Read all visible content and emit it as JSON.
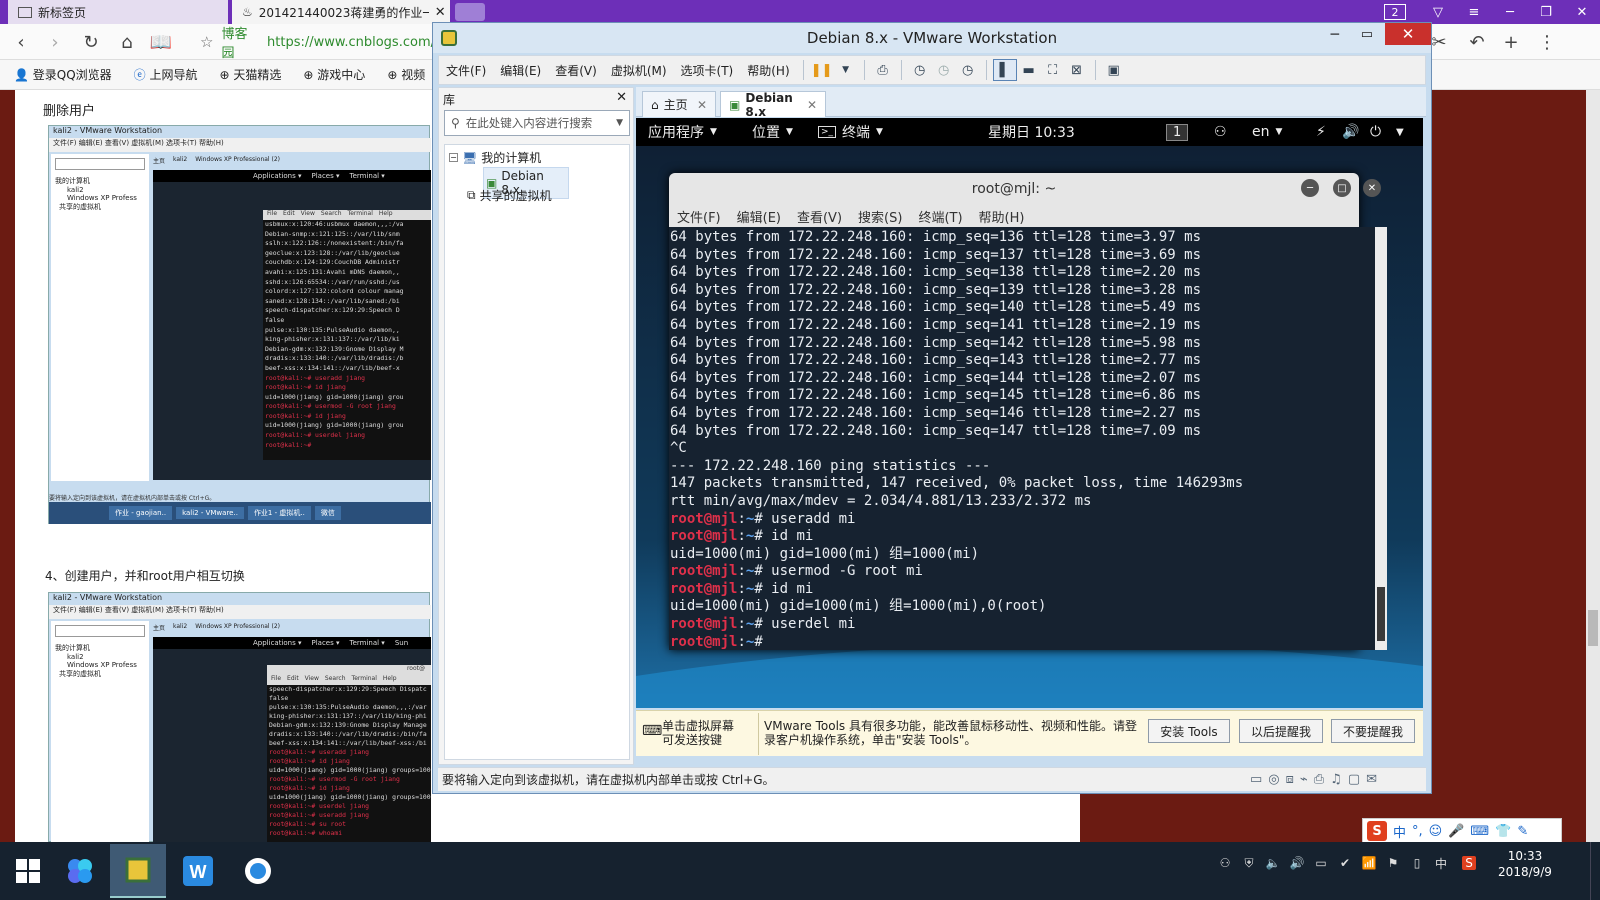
{
  "browser": {
    "tabs": [
      {
        "label": "新标签页"
      },
      {
        "label": "201421440023蒋建勇的作业一"
      }
    ],
    "tab_count_badge": "2",
    "url_site": "博客园",
    "url": "https://www.cnblogs.com/",
    "bookmarks": [
      "登录QQ浏览器",
      "上网导航",
      "天猫精选",
      "游戏中心",
      "视频"
    ]
  },
  "page": {
    "heading_delete_user": "删除用户",
    "heading_section4": "4、创建用户，并和root用户相互切换",
    "shot1": {
      "title": "kali2 - VMware Workstation",
      "tree": [
        "我的计算机",
        "kali2",
        "Windows XP Profess",
        "共享的虚拟机"
      ],
      "tabs": [
        "主页",
        "kali2",
        "Windows XP Professional (2)"
      ],
      "gnome": [
        "Applications ▾",
        "Places ▾",
        "Terminal ▾"
      ],
      "term_menu": [
        "File",
        "Edit",
        "View",
        "Search",
        "Terminal",
        "Help"
      ],
      "lines": [
        "usbmux:x:120:46:usbmux daemon,,,:/va",
        "Debian-snmp:x:121:125::/var/lib/snm",
        "sslh:x:122:126::/nonexistent:/bin/fa",
        "geoclue:x:123:128::/var/lib/geoclue",
        "couchdb:x:124:129:CouchDB Administr",
        "avahi:x:125:131:Avahi mDNS daemon,,",
        "sshd:x:126:65534::/var/run/sshd:/us",
        "colord:x:127:132:colord colour manag",
        "saned:x:128:134::/var/lib/saned:/bi",
        "speech-dispatcher:x:129:29:Speech D",
        "false",
        "pulse:x:130:135:PulseAudio daemon,,",
        "king-phisher:x:131:137::/var/lib/ki",
        "Debian-gdm:x:132:139:Gnome Display M",
        "dradis:x:133:140::/var/lib/dradis:/b",
        "beef-xss:x:134:141::/var/lib/beef-x",
        "root@kali:~# useradd jiang",
        "root@kali:~# id jiang",
        "uid=1000(jiang) gid=1000(jiang) grou",
        "root@kali:~# usermod -G root jiang",
        "root@kali:~# id jiang",
        "uid=1000(jiang) gid=1000(jiang) grou",
        "root@kali:~# userdel jiang",
        "root@kali:~# "
      ],
      "status": "要将输入定向到该虚拟机，请在虚拟机内部单击或按 Ctrl+G。",
      "taskbar": [
        "作业 - gaojian..",
        "kali2 - VMware..",
        "作业1 - 虚拟机..",
        "微信"
      ]
    },
    "shot2": {
      "title": "kali2 - VMware Workstation",
      "tree": [
        "我的计算机",
        "kali2",
        "Windows XP Profess",
        "共享的虚拟机"
      ],
      "tabs": [
        "主页",
        "kali2",
        "Windows XP Professional (2)"
      ],
      "gnome": [
        "Applications ▾",
        "Places ▾",
        "Terminal ▾",
        "Sun"
      ],
      "term_menu": [
        "File",
        "Edit",
        "View",
        "Search",
        "Terminal",
        "Help"
      ],
      "term_title": "root@",
      "lines": [
        "speech-dispatcher:x:129:29:Speech Dispatc",
        "false",
        "pulse:x:130:135:PulseAudio daemon,,,:/var",
        "king-phisher:x:131:137::/var/lib/king-phi",
        "Debian-gdm:x:132:139:Gnome Display Manage",
        "dradis:x:133:140::/var/lib/dradis:/bin/fa",
        "beef-xss:x:134:141::/var/lib/beef-xss:/bi",
        "root@kali:~# useradd jiang",
        "root@kali:~# id jiang",
        "uid=1000(jiang) gid=1000(jiang) groups=100",
        "root@kali:~# usermod -G root jiang",
        "root@kali:~# id jiang",
        "uid=1000(jiang) gid=1000(jiang) groups=1000(jiang),0(root)",
        "root@kali:~# userdel jiang",
        "root@kali:~# useradd jiang",
        "root@kali:~# su root",
        "root@kali:~# whoami"
      ]
    }
  },
  "vmware": {
    "title": "Debian 8.x - VMware Workstation",
    "menus": [
      "文件(F)",
      "编辑(E)",
      "查看(V)",
      "虚拟机(M)",
      "选项卡(T)",
      "帮助(H)"
    ],
    "library_title": "库",
    "search_placeholder": "在此处键入内容进行搜索",
    "tree": {
      "my_computer": "我的计算机",
      "vm": "Debian 8.x",
      "shared": "共享的虚拟机"
    },
    "tabs": [
      {
        "label": "主页"
      },
      {
        "label": "Debian 8.x"
      }
    ],
    "guest": {
      "gnome_apps": "应用程序",
      "gnome_places": "位置",
      "gnome_terminal": "终端",
      "clock": "星期日 10:33",
      "workspace": "1",
      "lang": "en"
    },
    "terminal": {
      "title": "root@mjl: ~",
      "menus": [
        "文件(F)",
        "编辑(E)",
        "查看(V)",
        "搜索(S)",
        "终端(T)",
        "帮助(H)"
      ],
      "lines": [
        {
          "text": "64 bytes from 172.22.248.160: icmp_seq=136 ttl=128 time=3.97 ms"
        },
        {
          "text": "64 bytes from 172.22.248.160: icmp_seq=137 ttl=128 time=3.69 ms"
        },
        {
          "text": "64 bytes from 172.22.248.160: icmp_seq=138 ttl=128 time=2.20 ms"
        },
        {
          "text": "64 bytes from 172.22.248.160: icmp_seq=139 ttl=128 time=3.28 ms"
        },
        {
          "text": "64 bytes from 172.22.248.160: icmp_seq=140 ttl=128 time=5.49 ms"
        },
        {
          "text": "64 bytes from 172.22.248.160: icmp_seq=141 ttl=128 time=2.19 ms"
        },
        {
          "text": "64 bytes from 172.22.248.160: icmp_seq=142 ttl=128 time=5.98 ms"
        },
        {
          "text": "64 bytes from 172.22.248.160: icmp_seq=143 ttl=128 time=2.77 ms"
        },
        {
          "text": "64 bytes from 172.22.248.160: icmp_seq=144 ttl=128 time=2.07 ms"
        },
        {
          "text": "64 bytes from 172.22.248.160: icmp_seq=145 ttl=128 time=6.86 ms"
        },
        {
          "text": "64 bytes from 172.22.248.160: icmp_seq=146 ttl=128 time=2.27 ms"
        },
        {
          "text": "64 bytes from 172.22.248.160: icmp_seq=147 ttl=128 time=7.09 ms"
        },
        {
          "text": "^C"
        },
        {
          "text": "--- 172.22.248.160 ping statistics ---"
        },
        {
          "text": "147 packets transmitted, 147 received, 0% packet loss, time 146293ms"
        },
        {
          "text": "rtt min/avg/max/mdev = 2.034/4.881/13.233/2.372 ms"
        },
        {
          "prompt": "root@mjl",
          "path": "~",
          "cmd": "# useradd mi"
        },
        {
          "prompt": "root@mjl",
          "path": "~",
          "cmd": "# id mi"
        },
        {
          "text": "uid=1000(mi) gid=1000(mi) 组=1000(mi)"
        },
        {
          "prompt": "root@mjl",
          "path": "~",
          "cmd": "# usermod -G root mi"
        },
        {
          "prompt": "root@mjl",
          "path": "~",
          "cmd": "# id mi"
        },
        {
          "text": "uid=1000(mi) gid=1000(mi) 组=1000(mi),0(root)"
        },
        {
          "prompt": "root@mjl",
          "path": "~",
          "cmd": "# userdel mi"
        },
        {
          "prompt": "root@mjl",
          "path": "~",
          "cmd": "# "
        }
      ]
    },
    "notification": {
      "hint": "单击虚拟屏幕\n可发送按键",
      "message": "VMware Tools 具有很多功能，能改善鼠标移动性、视频和性能。请登录客户机操作系统，单击\"安装 Tools\"。",
      "install": "安装 Tools",
      "later": "以后提醒我",
      "never": "不要提醒我"
    },
    "status": "要将输入定向到该虚拟机，请在虚拟机内部单击或按 Ctrl+G。"
  },
  "ime": {
    "label": "中"
  },
  "taskbar": {
    "time": "10:33",
    "date": "2018/9/9",
    "ime": "中"
  }
}
